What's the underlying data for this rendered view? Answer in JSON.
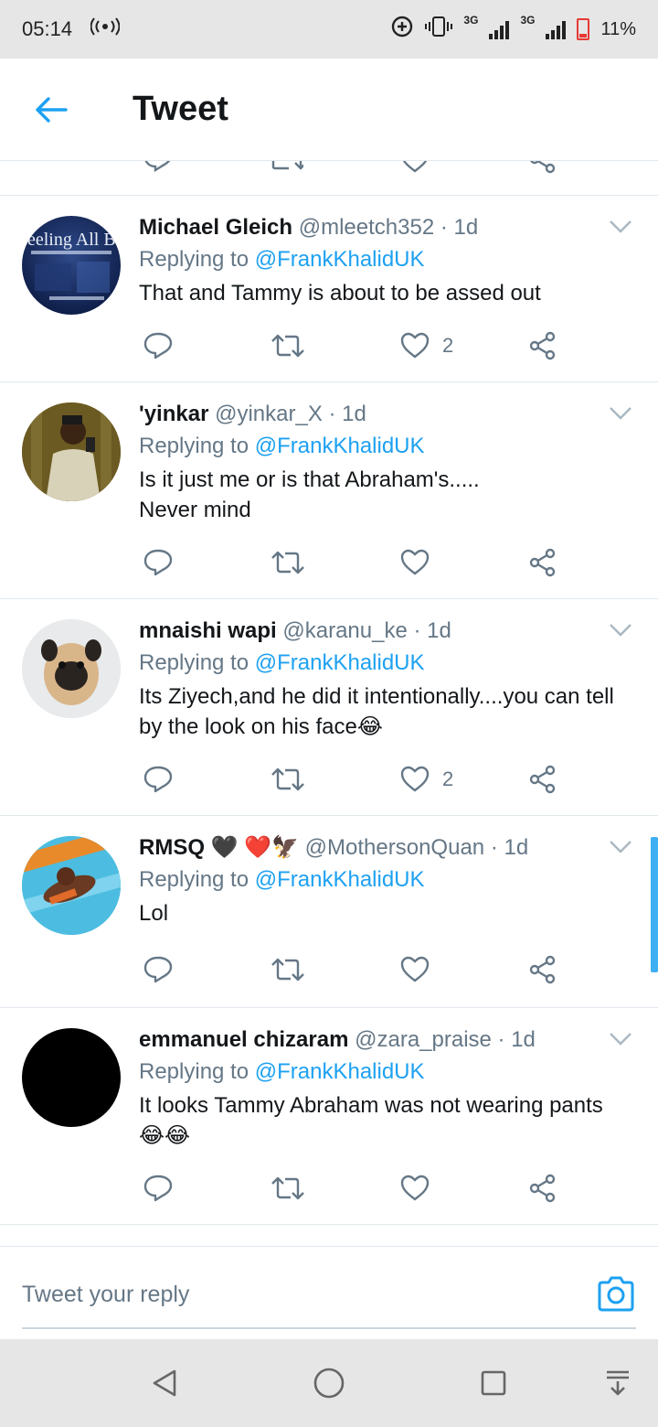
{
  "status": {
    "time": "05:14",
    "network1": "3G",
    "network2": "3G",
    "battery": "11%"
  },
  "header": {
    "title": "Tweet"
  },
  "tweets": [
    {
      "name": "Michael Gleich",
      "handle": "@mleetch352",
      "time": "· 1d",
      "reply_prefix": "Replying to ",
      "reply_to": "@FrankKhalidUK",
      "lines": [
        "That and Tammy is about to be assed out"
      ],
      "likes": "2",
      "avatar_text": "eeling All Blue"
    },
    {
      "name": "'yinkar",
      "handle": "@yinkar_X",
      "time": "· 1d",
      "reply_prefix": "Replying to ",
      "reply_to": "@FrankKhalidUK",
      "lines": [
        "Is it just me or is that Abraham's.....",
        "Never mind"
      ],
      "likes": ""
    },
    {
      "name": "mnaishi wapi",
      "handle": "@karanu_ke",
      "time": "· 1d",
      "reply_prefix": "Replying to ",
      "reply_to": "@FrankKhalidUK",
      "lines": [
        "Its Ziyech,and he did it intentionally....you can tell",
        "by the look on his face😂"
      ],
      "likes": "2"
    },
    {
      "name": "RMSQ",
      "name_emoji": "🖤 ❤️🦅",
      "handle": "@MothersonQuan",
      "time": "· 1d",
      "reply_prefix": "Replying to ",
      "reply_to": "@FrankKhalidUK",
      "lines": [
        "Lol"
      ],
      "likes": ""
    },
    {
      "name": "emmanuel chizaram",
      "handle": "@zara_praise",
      "time": "· 1d",
      "reply_prefix": "Replying to ",
      "reply_to": "@FrankKhalidUK",
      "lines": [
        "It looks Tammy Abraham was not wearing pants",
        "😂😂"
      ],
      "likes": ""
    }
  ],
  "reply_bar": {
    "placeholder": "Tweet your reply"
  },
  "colors": {
    "accent": "#1da1f2",
    "muted": "#657786",
    "divider": "#e1e8ed"
  },
  "icons": [
    "back-arrow-icon",
    "reply-icon",
    "retweet-icon",
    "like-icon",
    "share-icon",
    "chevron-down-icon",
    "camera-icon",
    "nav-back-icon",
    "nav-home-icon",
    "nav-recents-icon",
    "nav-notifications-icon"
  ]
}
